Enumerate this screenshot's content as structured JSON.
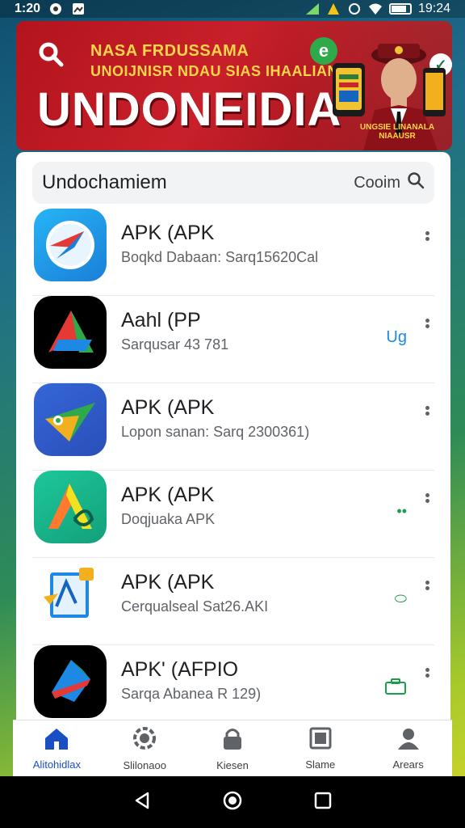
{
  "status_bar": {
    "time_left": "1:20",
    "time_right": "19:24",
    "icons": [
      "alarm-icon",
      "clock-icon",
      "image-icon",
      "signal-icon",
      "warning-icon",
      "wifi-icon",
      "battery-icon"
    ]
  },
  "banner": {
    "line1": "NASA FRDUSSAMA",
    "line2": "UNOIJNISR NDAU SIAS IHAALIAN",
    "title": "UNDONEIDIA",
    "badge": "UNGSIE LINANALA NIAAUSR"
  },
  "search": {
    "title": "Undochamiem",
    "action_label": "Cooim"
  },
  "apps": [
    {
      "name": "APK (APK",
      "subtitle": "Boqkd Dabaan: Sarq15620Cal",
      "action": "",
      "icon": "safari-icon",
      "colors": [
        "#1ea7f0",
        "#e53935"
      ]
    },
    {
      "name": "Aahl (PP",
      "subtitle": "Sarqusar 43 781",
      "action": "Ug",
      "icon": "arrow-a-icon",
      "colors": [
        "#000000",
        "#2eaa4a"
      ]
    },
    {
      "name": "APK (APK",
      "subtitle": "Lopon sanan: Sarq 2300361)",
      "action": "",
      "icon": "paper-plane-icon",
      "colors": [
        "#2f5fd0",
        "#f2b01e"
      ]
    },
    {
      "name": "APK (APK",
      "subtitle": "Doqjuaka APK",
      "action": "••",
      "icon": "vector-icon",
      "colors": [
        "#14b28a",
        "#ff7a2f"
      ]
    },
    {
      "name": "APK (APK",
      "subtitle": "Cerqualseal Sat26.AKI",
      "action": "⬭",
      "icon": "document-icon",
      "colors": [
        "#ffffff",
        "#1e88e5"
      ]
    },
    {
      "name": "APK' (AFPIO",
      "subtitle": "Sarqa Abanea R 129)",
      "action": "",
      "icon": "shield-icon",
      "colors": [
        "#000000",
        "#e53935"
      ]
    }
  ],
  "bottom_nav": [
    {
      "label": "Alitohidlax",
      "icon": "home-icon",
      "active": true
    },
    {
      "label": "Slilonaoo",
      "icon": "settings-icon",
      "active": false
    },
    {
      "label": "Kiesen",
      "icon": "lock-icon",
      "active": false
    },
    {
      "label": "Slame",
      "icon": "tablet-icon",
      "active": false
    },
    {
      "label": "Arears",
      "icon": "person-icon",
      "active": false
    }
  ],
  "accent_color": "#1a4fc4"
}
